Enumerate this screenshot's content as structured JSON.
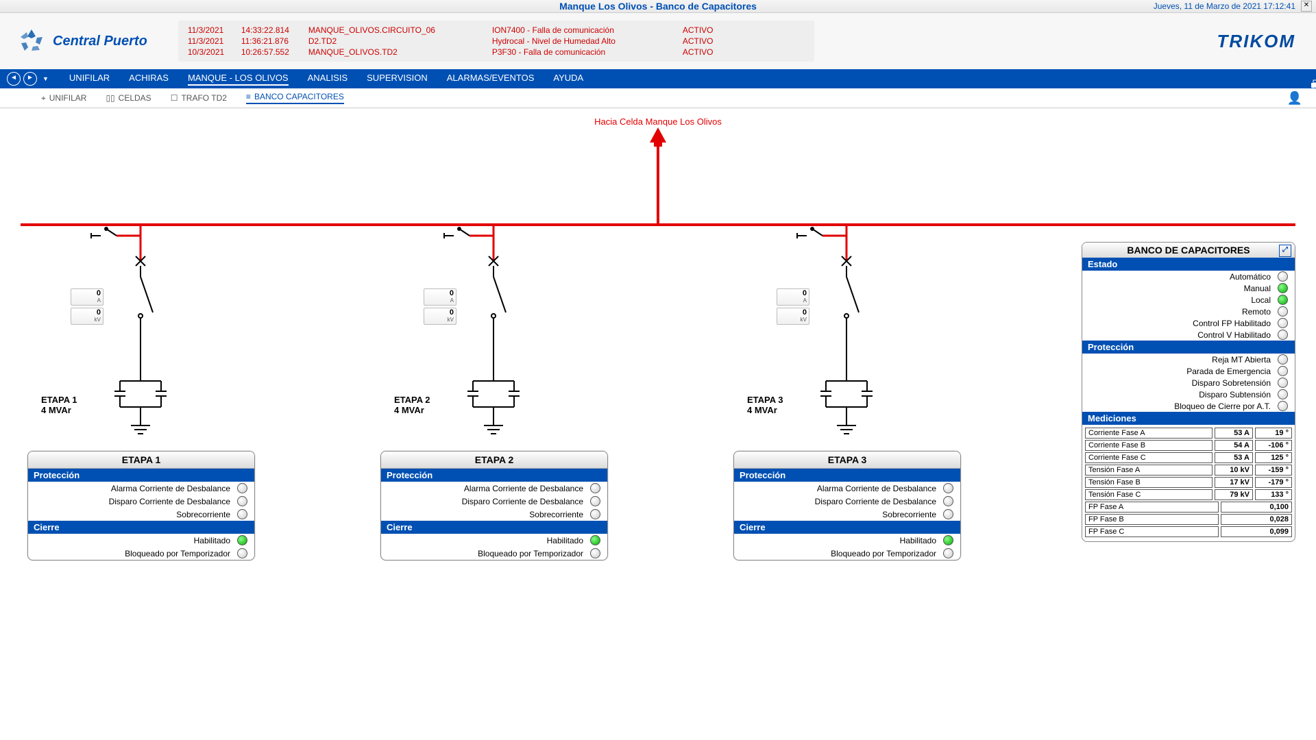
{
  "top": {
    "title": "Manque Los Olivos - Banco de Capacitores",
    "datetime": "Jueves, 11 de Marzo de 2021 17:12:41",
    "close": "✕"
  },
  "logo_left": "Central Puerto",
  "logo_right": "TRIKOM",
  "alarms": [
    {
      "date": "11/3/2021",
      "time": "14:33:22.814",
      "src": "MANQUE_OLIVOS.CIRCUITO_06",
      "msg": "ION7400 - Falla de comunicación",
      "stat": "ACTIVO"
    },
    {
      "date": "11/3/2021",
      "time": "11:36:21.876",
      "src": "D2.TD2",
      "msg": "Hydrocal - Nivel de Humedad Alto",
      "stat": "ACTIVO"
    },
    {
      "date": "10/3/2021",
      "time": "10:26:57.552",
      "src": "MANQUE_OLIVOS.TD2",
      "msg": "P3F30 - Falla de comunicación",
      "stat": "ACTIVO"
    }
  ],
  "menu": [
    "UNIFILAR",
    "ACHIRAS",
    "MANQUE - LOS OLIVOS",
    "ANALISIS",
    "SUPERVISION",
    "ALARMAS/EVENTOS",
    "AYUDA"
  ],
  "menu_active": 2,
  "submenu": [
    "UNIFILAR",
    "CELDAS",
    "TRAFO TD2",
    "BANCO CAPACITORES"
  ],
  "submenu_active": 3,
  "label_top": "Hacia Celda Manque Los Olivos",
  "stages": [
    {
      "name": "ETAPA 1",
      "rating": "4 MVAr",
      "amps": "0",
      "kv": "0"
    },
    {
      "name": "ETAPA 2",
      "rating": "4 MVAr",
      "amps": "0",
      "kv": "0"
    },
    {
      "name": "ETAPA 3",
      "rating": "4 MVAr",
      "amps": "0",
      "kv": "0"
    }
  ],
  "etapa_panel": {
    "proteccion_hdr": "Protección",
    "cierre_hdr": "Cierre",
    "rows_prot": [
      "Alarma Corriente de Desbalance",
      "Disparo Corriente de Desbalance",
      "Sobrecorriente"
    ],
    "rows_cierre": [
      {
        "lbl": "Habilitado",
        "on": true
      },
      {
        "lbl": "Bloqueado por Temporizador",
        "on": false
      }
    ]
  },
  "side": {
    "title": "BANCO DE CAPACITORES",
    "estado_hdr": "Estado",
    "estado": [
      {
        "lbl": "Automático",
        "on": false
      },
      {
        "lbl": "Manual",
        "on": true
      },
      {
        "lbl": "Local",
        "on": true
      },
      {
        "lbl": "Remoto",
        "on": false
      },
      {
        "lbl": "Control FP Habilitado",
        "on": false
      },
      {
        "lbl": "Control V Habilitado",
        "on": false
      }
    ],
    "prot_hdr": "Protección",
    "prot": [
      "Reja MT Abierta",
      "Parada de Emergencia",
      "Disparo Sobretensión",
      "Disparo Subtensión",
      "Bloqueo de Cierre por A.T."
    ],
    "med_hdr": "Mediciones",
    "med": [
      {
        "n": "Corriente Fase A",
        "v": "53 A",
        "a": "19 °"
      },
      {
        "n": "Corriente Fase B",
        "v": "54 A",
        "a": "-106 °"
      },
      {
        "n": "Corriente Fase C",
        "v": "53 A",
        "a": "125 °"
      },
      {
        "n": "Tensión Fase A",
        "v": "10 kV",
        "a": "-159 °"
      },
      {
        "n": "Tensión Fase B",
        "v": "17 kV",
        "a": "-179 °"
      },
      {
        "n": "Tensión Fase C",
        "v": "79 kV",
        "a": "133 °"
      },
      {
        "n": "FP Fase A",
        "v": "0,100"
      },
      {
        "n": "FP Fase B",
        "v": "0,028"
      },
      {
        "n": "FP Fase C",
        "v": "0,099"
      }
    ]
  }
}
